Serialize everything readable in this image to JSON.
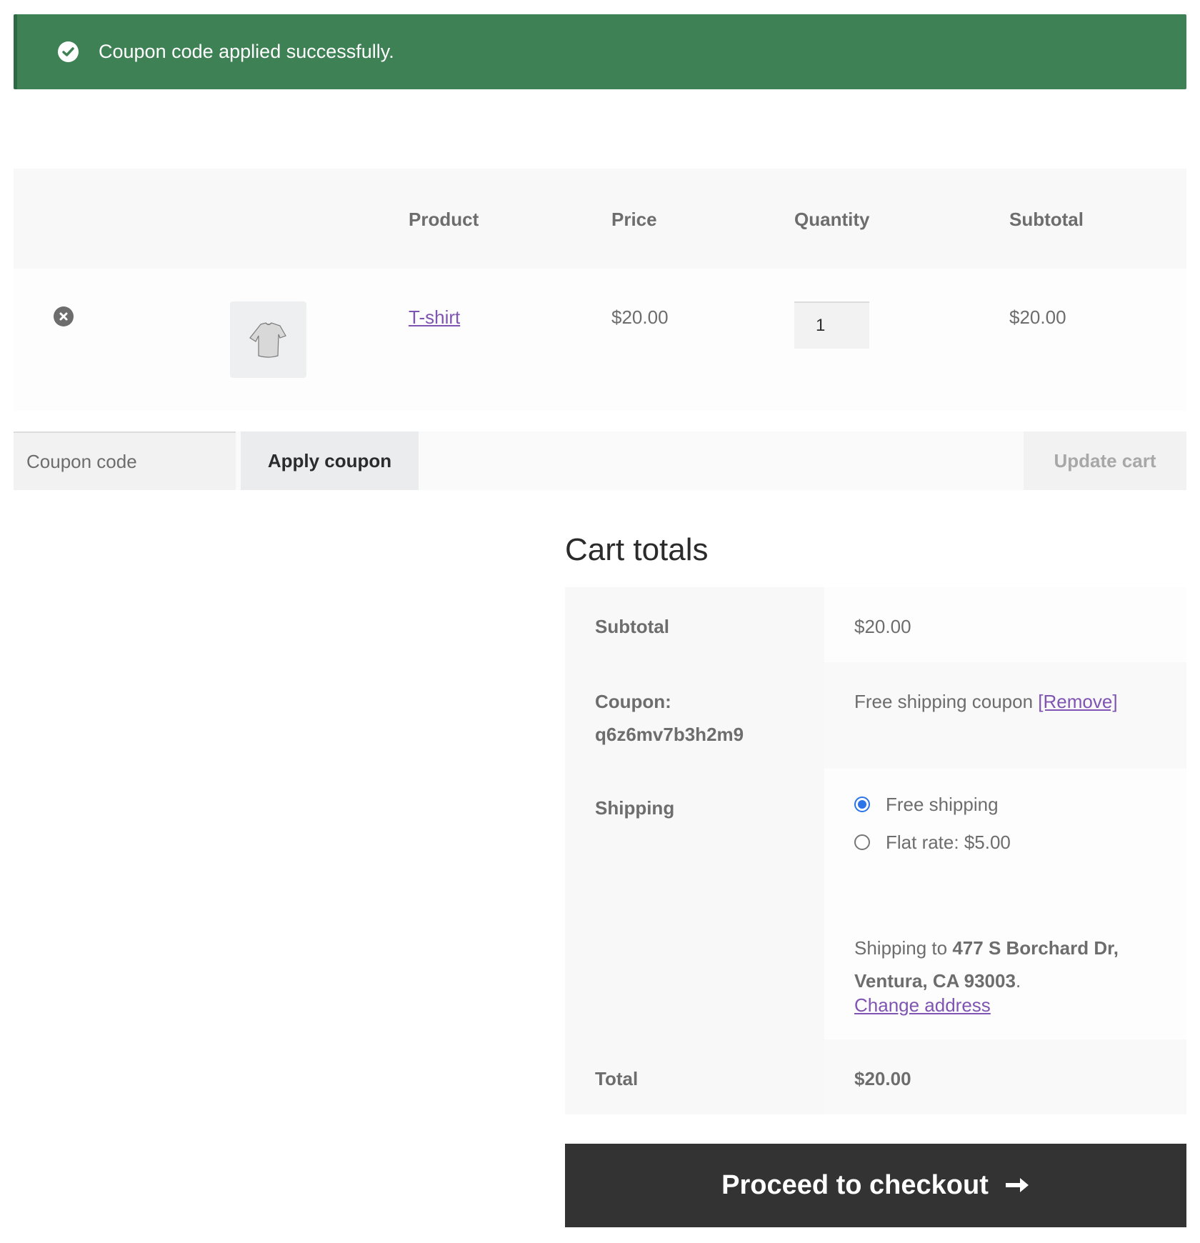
{
  "notice": {
    "message": "Coupon code applied successfully.",
    "icon": "check-circle-icon",
    "color": "#3d8155"
  },
  "cart": {
    "columns": [
      "",
      "",
      "Product",
      "Price",
      "Quantity",
      "Subtotal"
    ],
    "items": [
      {
        "remove_icon": "remove-circle-icon",
        "thumbnail": "t-shirt-image",
        "product": "T-shirt",
        "price": "$20.00",
        "quantity": "1",
        "subtotal": "$20.00"
      }
    ]
  },
  "actions": {
    "coupon_placeholder": "Coupon code",
    "coupon_value": "",
    "apply_label": "Apply coupon",
    "update_label": "Update cart"
  },
  "totals": {
    "title": "Cart totals",
    "subtotal_label": "Subtotal",
    "subtotal_value": "$20.00",
    "coupon_label": "Coupon:",
    "coupon_code": "q6z6mv7b3h2m9",
    "coupon_value": "Free shipping coupon",
    "coupon_remove": "[Remove]",
    "shipping_label": "Shipping",
    "shipping_options": [
      {
        "label": "Free shipping",
        "checked": true
      },
      {
        "label": "Flat rate: $5.00",
        "checked": false
      }
    ],
    "shipping_to_prefix": "Shipping to",
    "shipping_address": "477 S Borchard Dr, Ventura, CA 93003",
    "shipping_to_suffix": ".",
    "change_address": "Change address",
    "total_label": "Total",
    "total_value": "$20.00"
  },
  "checkout": {
    "label": "Proceed to checkout",
    "icon": "arrow-right-icon"
  },
  "colors": {
    "link": "#7f54b3",
    "radio_checked": "#2a73e8",
    "checkout_bg": "#333333"
  }
}
